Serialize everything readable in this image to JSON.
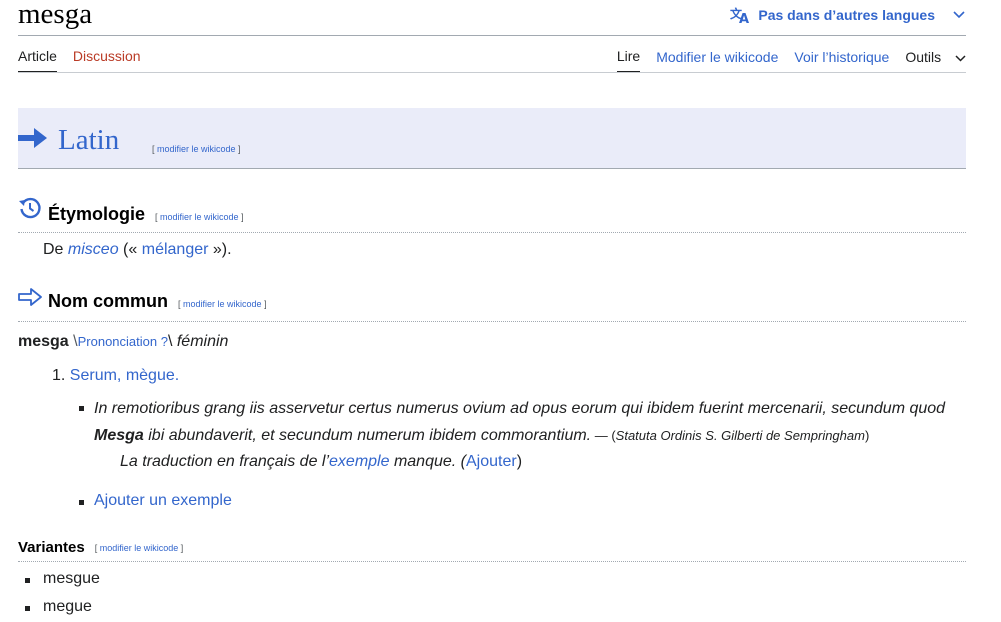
{
  "page": {
    "title": "mesga",
    "languages_button": "Pas dans d’autres langues"
  },
  "tabs": {
    "article": "Article",
    "discussion": "Discussion",
    "read": "Lire",
    "edit": "Modifier le wikicode",
    "history": "Voir l’historique",
    "tools": "Outils"
  },
  "language_section": {
    "name": "Latin",
    "edit": "modifier le wikicode"
  },
  "etymology": {
    "heading": "Étymologie",
    "edit": "modifier le wikicode",
    "prefix": "De",
    "source_word": "misceo",
    "open_quote": "(«",
    "gloss": "mélanger",
    "close_quote": "»)."
  },
  "noun": {
    "heading": "Nom commun",
    "edit": "modifier le wikicode",
    "headword": "mesga",
    "pron_open": "\\",
    "pronunciation": "Prononciation ?",
    "pron_close": "\\",
    "gender": "féminin",
    "definition_number": "1.",
    "definition": "Serum, mègue.",
    "example_line1": "In remotioribus grang iis asservetur certus numerus ovium ad opus eorum qui ibidem fuerint mercenarii, secundum quod",
    "example_bold": "Mesga",
    "example_line2": " ibi abundaverit, et secundum numerum ibidem commorantium.",
    "example_dash": " — (",
    "example_source": "Statuta Ordinis S. Gilberti de Sempringham",
    "example_source_close": ")",
    "translation_prefix": "La traduction en français de l’",
    "translation_link": "exemple",
    "translation_suffix": " manque. (",
    "translation_add": "Ajouter",
    "translation_close": ")",
    "add_example": "Ajouter un exemple"
  },
  "variants": {
    "heading": "Variantes",
    "edit": "modifier le wikicode",
    "items": [
      "mesgue",
      "megue"
    ]
  },
  "colors": {
    "link": "#3366cc",
    "visited_link": "#795cb2",
    "red_link": "#ba3b26",
    "language_header_bg": "#eaecf9"
  }
}
